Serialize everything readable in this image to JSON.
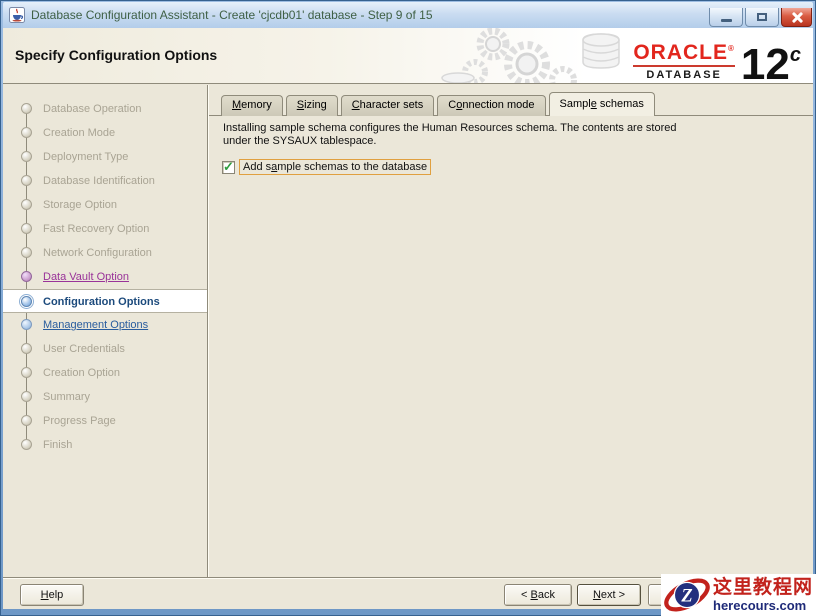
{
  "window": {
    "title": "Database Configuration Assistant - Create 'cjcdb01' database - Step 9 of 15"
  },
  "header": {
    "title": "Specify Configuration Options",
    "logo": {
      "name": "ORACLE",
      "reg": "®",
      "product": "DATABASE",
      "version": "12",
      "edition": "c"
    }
  },
  "sidebar": {
    "steps": [
      {
        "label": "Database Operation",
        "state": "pending"
      },
      {
        "label": "Creation Mode",
        "state": "pending"
      },
      {
        "label": "Deployment Type",
        "state": "pending"
      },
      {
        "label": "Database Identification",
        "state": "pending"
      },
      {
        "label": "Storage Option",
        "state": "pending"
      },
      {
        "label": "Fast Recovery Option",
        "state": "pending"
      },
      {
        "label": "Network Configuration",
        "state": "pending"
      },
      {
        "label": "Data Vault Option",
        "state": "visited-link"
      },
      {
        "label": "Configuration Options",
        "state": "current"
      },
      {
        "label": "Management Options",
        "state": "link"
      },
      {
        "label": "User Credentials",
        "state": "pending"
      },
      {
        "label": "Creation Option",
        "state": "pending"
      },
      {
        "label": "Summary",
        "state": "pending"
      },
      {
        "label": "Progress Page",
        "state": "pending"
      },
      {
        "label": "Finish",
        "state": "pending"
      }
    ]
  },
  "tabs": [
    {
      "pre": "",
      "key": "M",
      "post": "emory",
      "active": false
    },
    {
      "pre": "",
      "key": "S",
      "post": "izing",
      "active": false
    },
    {
      "pre": "",
      "key": "C",
      "post": "haracter sets",
      "active": false
    },
    {
      "pre": "C",
      "key": "o",
      "post": "nnection mode",
      "active": false
    },
    {
      "pre": "Sampl",
      "key": "e",
      "post": " schemas",
      "active": true
    }
  ],
  "content": {
    "description_line1": "Installing sample schema configures the Human Resources schema. The contents are stored",
    "description_line2": "under the SYSAUX tablespace.",
    "checkbox": {
      "checked": true,
      "check_glyph": "✓",
      "label_pre": "Add s",
      "label_key": "a",
      "label_post": "mple schemas to the database"
    }
  },
  "footer": {
    "help": {
      "pre": "",
      "key": "H",
      "post": "elp"
    },
    "back": {
      "pre": "< ",
      "key": "B",
      "post": "ack"
    },
    "next": {
      "pre": "",
      "key": "N",
      "post": "ext >"
    }
  },
  "watermark": {
    "text_cn": "这里教程网",
    "text_en": "herecours.com",
    "logo_letter": "Z"
  },
  "colors": {
    "titlebar_blue": "#b3cdea",
    "client_beige": "#ebe7d9",
    "oracle_red": "#e2261d",
    "visited_link_purple": "#993399",
    "next_link_blue": "#2a5d9e",
    "current_step_navy": "#1c4a7c",
    "focus_rect_orange": "#e0a040",
    "check_green": "#2f9e3f",
    "watermark_red": "#c2221c",
    "watermark_navy": "#1e2a78"
  }
}
